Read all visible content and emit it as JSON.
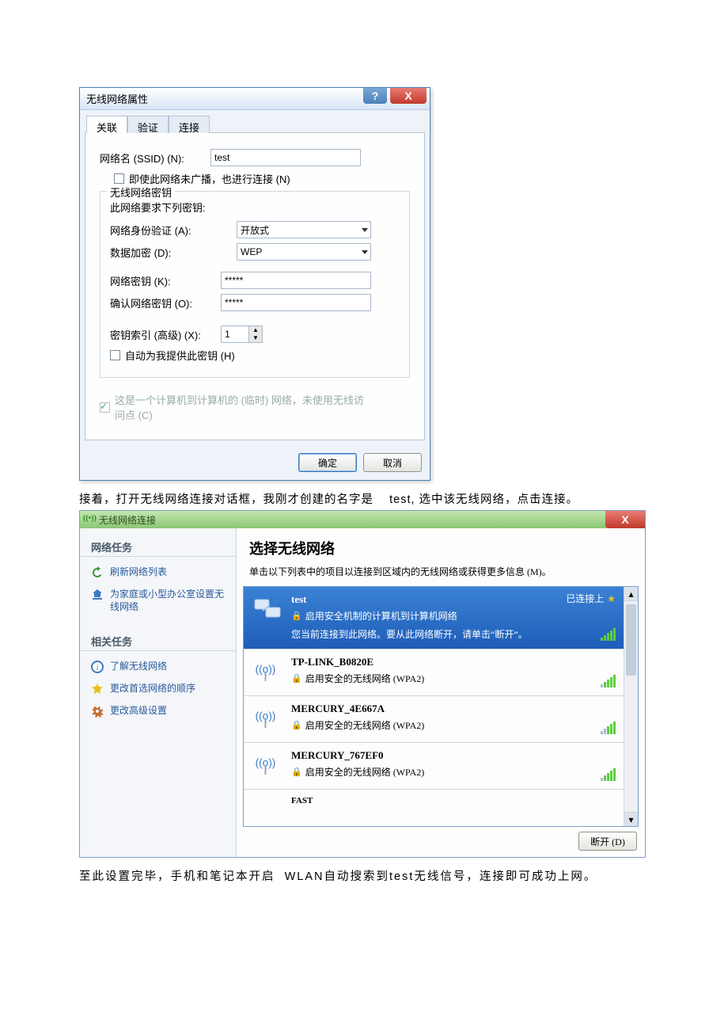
{
  "dialog1": {
    "title": "无线网络属性",
    "tabs": {
      "assoc": "关联",
      "auth": "验证",
      "conn": "连接"
    },
    "ssid_label": "网络名 (SSID) (N):",
    "ssid_value": "test",
    "connect_if_not_broadcast": "即使此网络未广播，也进行连接 (N)",
    "key_group_title": "无线网络密钥",
    "key_desc": "此网络要求下列密钥:",
    "auth_label": "网络身份验证 (A):",
    "auth_value": "开放式",
    "enc_label": "数据加密 (D):",
    "enc_value": "WEP",
    "key_label": "网络密钥 (K):",
    "key_value": "*****",
    "key_confirm_label": "确认网络密钥 (O):",
    "key_confirm_value": "*****",
    "key_index_label": "密钥索引 (高级) (X):",
    "key_index_value": "1",
    "auto_key": "自动为我提供此密钥 (H)",
    "adhoc_label": "这是一个计算机到计算机的 (临时) 网络，未使用无线访问点 (C)",
    "ok": "确定",
    "cancel": "取消"
  },
  "caption1_a": "接着，打开无线网络连接对话框，我刚才创建的名字是",
  "caption1_b": "test, 选中该无线网络，点击连接。",
  "win2": {
    "title": "无线网络连接",
    "sidebar": {
      "head1": "网络任务",
      "refresh": "刷新网络列表",
      "home_setup": "为家庭或小型办公室设置无线网络",
      "head2": "相关任务",
      "learn": "了解无线网络",
      "change_order": "更改首选网络的顺序",
      "advanced": "更改高级设置"
    },
    "main_head": "选择无线网络",
    "main_sub": "单击以下列表中的项目以连接到区域内的无线网络或获得更多信息 (M)。",
    "networks": [
      {
        "name": "test",
        "desc": "启用安全机制的计算机到计算机网络",
        "msg": "您当前连接到此网络。要从此网络断开，请单击“断开”。",
        "status": "已连接上",
        "selected": true,
        "type": "adhoc"
      },
      {
        "name": "TP-LINK_B0820E",
        "desc": "启用安全的无线网络 (WPA2)",
        "selected": false,
        "type": "infra"
      },
      {
        "name": "MERCURY_4E667A",
        "desc": "启用安全的无线网络 (WPA2)",
        "selected": false,
        "type": "infra"
      },
      {
        "name": "MERCURY_767EF0",
        "desc": "启用安全的无线网络 (WPA2)",
        "selected": false,
        "type": "infra"
      }
    ],
    "partial_row": "FAST",
    "disconnect": "断开 (D)"
  },
  "caption2_a": "至此设置完毕，手机和笔记本开启",
  "caption2_b": "WLAN自动搜索到test无线信号，连接即可成功上网。"
}
